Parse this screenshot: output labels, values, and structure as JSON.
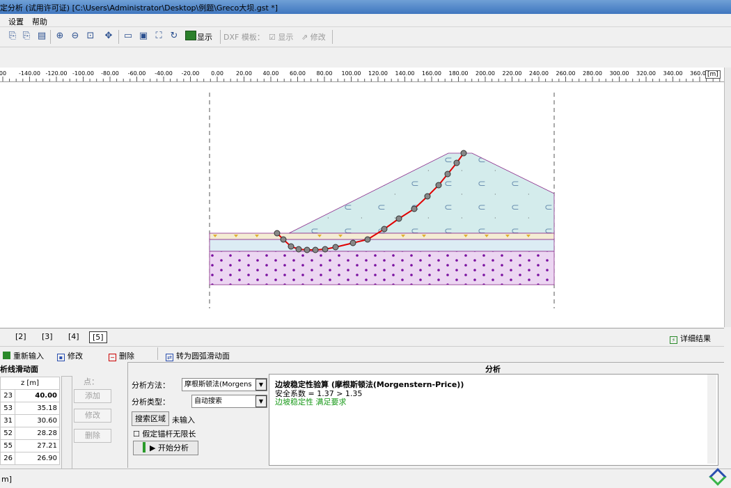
{
  "window": {
    "title": "定分析 (试用许可证) [C:\\Users\\Administrator\\Desktop\\例题\\Greco大坝.gst *]"
  },
  "menu": {
    "items": [
      "设置",
      "帮助"
    ]
  },
  "toolbar": {
    "display_label": "显示",
    "dxf_label": "DXF 模板：",
    "dxf_show_label": "显示",
    "dxf_edit_label": "修改"
  },
  "ruler": {
    "ticks": [
      "00",
      "-140.00",
      "-120.00",
      "-100.00",
      "-80.00",
      "-60.00",
      "-40.00",
      "-20.00",
      "0.00",
      "20.00",
      "40.00",
      "60.00",
      "80.00",
      "100.00",
      "120.00",
      "140.00",
      "160.00",
      "180.00",
      "200.00",
      "220.00",
      "240.00",
      "260.00",
      "280.00",
      "300.00",
      "320.00",
      "340.00",
      "360.00"
    ],
    "unit": "[m]"
  },
  "tabs": {
    "items": [
      "[2]",
      "[3]",
      "[4]",
      "[5]"
    ],
    "active": "[5]",
    "detail_label": "详细结果"
  },
  "actions": {
    "reinput": "重新输入",
    "edit": "修改",
    "delete": "删除",
    "to_circular": "转为圆弧滑动面"
  },
  "left_panel": {
    "title": "析线滑动面",
    "col_z": "z [m]",
    "rows": [
      {
        "x": "23",
        "z": "40.00"
      },
      {
        "x": "53",
        "z": "35.18"
      },
      {
        "x": "31",
        "z": "30.60"
      },
      {
        "x": "52",
        "z": "28.28"
      },
      {
        "x": "55",
        "z": "27.21"
      },
      {
        "x": "26",
        "z": "26.90"
      }
    ],
    "points_label": "点：",
    "add": "添加",
    "modify": "修改",
    "remove": "删除"
  },
  "analysis_panel": {
    "method_label": "分析方法：",
    "method_value": "摩根斯顿法(Morgens",
    "type_label": "分析类型：",
    "type_value": "自动搜索",
    "search_area_button": "搜索区域",
    "search_area_status": "未输入",
    "anchor_checkbox": "假定锚杆无限长",
    "start_button": "开始分析"
  },
  "results": {
    "header": "分析",
    "title": "边坡稳定性验算 (摩根斯顿法(Morgenstern-Price))",
    "factor_line": "安全系数 = 1.37 > 1.35",
    "status_line": "边坡稳定性 满足要求",
    "status_color": "#1a9a1a"
  },
  "statusbar": {
    "text": "m]"
  },
  "colors": {
    "accent": "#2a4f8f",
    "slip_curve": "#e00000"
  }
}
